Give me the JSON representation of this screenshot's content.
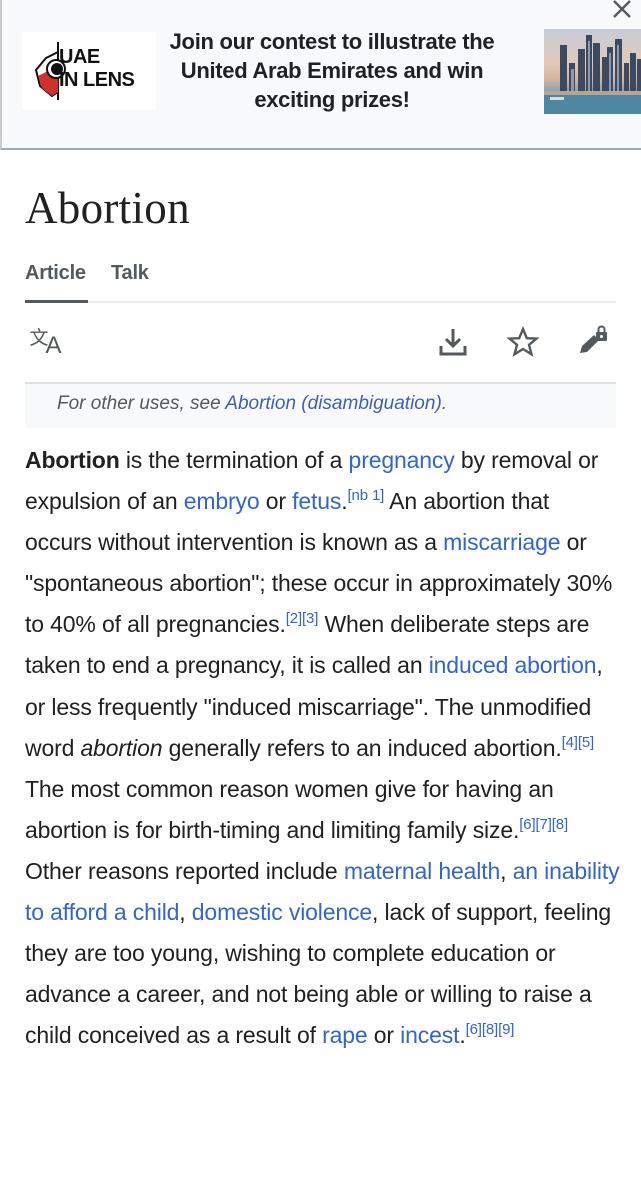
{
  "banner": {
    "logo_line1": "UAE",
    "logo_line2": "IN LENS",
    "headline": "Join our contest to illustrate the United Arab Emirates and win exciting prizes!",
    "image_alt": "Dubai skyline",
    "close_icon": "close-icon"
  },
  "page": {
    "title": "Abortion"
  },
  "tabs": [
    {
      "label": "Article",
      "active": true
    },
    {
      "label": "Talk",
      "active": false
    }
  ],
  "toolbar": {
    "language_icon": "language-icon",
    "language_glyph_1": "文",
    "language_glyph_2": "A",
    "download_icon": "download-icon",
    "watch_icon": "star-icon",
    "edit_icon": "edit-locked-icon"
  },
  "hatnote": {
    "prefix": "For other uses, see ",
    "link": "Abortion (disambiguation)",
    "suffix": "."
  },
  "paragraph": {
    "s1_bold": "Abortion",
    "s1_a": " is the termination of a ",
    "l_pregnancy": "pregnancy",
    "s1_b": " by removal or expulsion of an ",
    "l_embryo": "embryo",
    "s1_c": " or ",
    "l_fetus": "fetus",
    "s1_d": ".",
    "ref_nb1": "[nb 1]",
    "s2_a": " An abortion that occurs without intervention is known as a ",
    "l_miscarriage": "miscarriage",
    "s2_b": " or \"spontaneous abortion\"; these occur in approximately 30% to 40% of all pregnancies.",
    "ref_2": "[2]",
    "ref_3": "[3]",
    "s3_a": " When deliberate steps are taken to end a pregnancy, it is called an ",
    "l_induced_abortion": "induced abortion",
    "s3_b": ", or less frequently \"induced miscarriage\". The unmodified word ",
    "s3_italic": "abortion",
    "s3_c": " generally refers to an induced abortion.",
    "ref_4": "[4]",
    "ref_5": "[5]",
    "s4_a": " The most common reason women give for having an abortion is for birth-timing and limiting family size.",
    "ref_6": "[6]",
    "ref_7": "[7]",
    "ref_8": "[8]",
    "s5_a": " Other reasons reported include ",
    "l_maternal_health": "maternal health",
    "s5_b": ", ",
    "l_inability": "an inability to afford a child",
    "s5_c": ", ",
    "l_domestic_violence": "domestic violence",
    "s5_d": ", lack of support, feeling they are too young, wishing to complete education or advance a career, and not being able or willing to raise a child conceived as a result of ",
    "l_rape": "rape",
    "s5_e": " or ",
    "l_incest": "incest",
    "s5_f": ".",
    "ref_6b": "[6]",
    "ref_8b": "[8]",
    "ref_9": "[9]"
  },
  "colors": {
    "link": "#3366cc",
    "text": "#202122",
    "muted": "#54595d",
    "hatnote_bg": "#f8f9fa"
  }
}
